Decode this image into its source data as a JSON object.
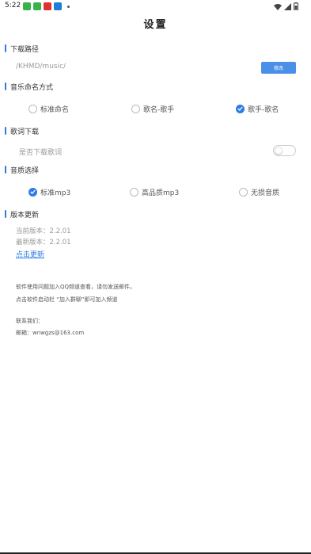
{
  "status_bar": {
    "time": "5:22",
    "left_icons": [
      "green-app-icon",
      "green-app-icon",
      "red-app-icon",
      "blue-app-icon",
      "notification-dot-icon"
    ],
    "right_icons": [
      "wifi-icon",
      "signal-icon",
      "battery-icon"
    ]
  },
  "page": {
    "title": "设置"
  },
  "download_path": {
    "header": "下载路径",
    "path": "/KHMD/music/",
    "modify_label": "修改"
  },
  "naming": {
    "header": "音乐命名方式",
    "options": [
      {
        "label": "标准命名",
        "checked": false
      },
      {
        "label": "歌名-歌手",
        "checked": false
      },
      {
        "label": "歌手-歌名",
        "checked": true
      }
    ]
  },
  "lyrics": {
    "header": "歌词下载",
    "toggle_label": "是否下载歌词",
    "enabled": false
  },
  "quality": {
    "header": "音质选择",
    "options": [
      {
        "label": "标准mp3",
        "checked": true
      },
      {
        "label": "高品质mp3",
        "checked": false
      },
      {
        "label": "无损音质",
        "checked": false
      }
    ]
  },
  "version": {
    "header": "版本更新",
    "current": "当前版本：2.2.01",
    "latest": "最新版本：2.2.01",
    "update_link": "点击更新"
  },
  "info": {
    "line1": "软件使用问题加入QQ频道查看，请勿发送邮件。",
    "line2": "点击软件启动栏 “加入群聊”即可加入频道",
    "contact_label": "联系我们：",
    "email": "邮箱：wnwgzs@163.com"
  },
  "colors": {
    "accent": "#2f7be6",
    "button": "#4a90e8"
  }
}
